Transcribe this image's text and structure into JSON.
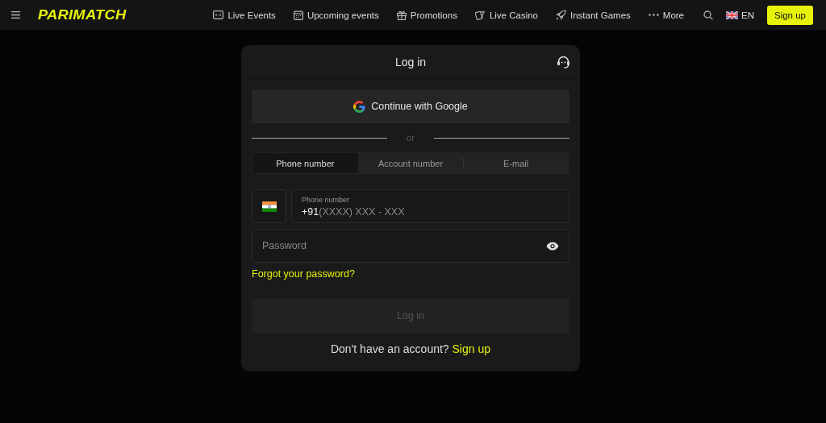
{
  "header": {
    "logo": "PARIMATCH",
    "nav": [
      {
        "label": "Live Events",
        "kind": "scoreboard"
      },
      {
        "label": "Upcoming events",
        "kind": "calendar"
      },
      {
        "label": "Promotions",
        "kind": "gift"
      },
      {
        "label": "Live Casino",
        "kind": "cards"
      },
      {
        "label": "Instant Games",
        "kind": "rocket"
      },
      {
        "label": "More",
        "kind": "dots"
      }
    ],
    "language": "EN",
    "signup": "Sign up"
  },
  "login": {
    "title": "Log in",
    "google_button": "Continue with Google",
    "divider": "or",
    "tabs": [
      {
        "label": "Phone number",
        "selected": true
      },
      {
        "label": "Account number",
        "selected": false
      },
      {
        "label": "E-mail",
        "selected": false
      }
    ],
    "phone": {
      "label": "Phone number",
      "prefix": "+91",
      "placeholder": "(XXXX) XXX - XXX"
    },
    "password": {
      "placeholder": "Password"
    },
    "forgot": "Forgot your password?",
    "submit": {
      "label": "Log in",
      "disabled": true
    },
    "signup_prompt": "Don't have an account?",
    "signup_link": "Sign up"
  }
}
